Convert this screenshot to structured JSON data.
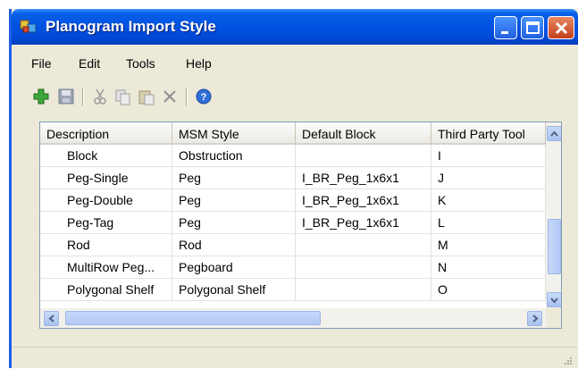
{
  "window": {
    "title": "Planogram Import Style"
  },
  "menu": [
    "File",
    "Edit",
    "Tools",
    "Help"
  ],
  "toolbar": {
    "icons": [
      "add-icon",
      "save-icon",
      "cut-icon",
      "copy-icon",
      "paste-icon",
      "delete-icon",
      "help-icon"
    ]
  },
  "grid": {
    "columns": [
      "Description",
      "MSM Style",
      "Default Block",
      "Third Party Tool"
    ],
    "rows": [
      [
        "Block",
        "Obstruction",
        "",
        "I"
      ],
      [
        "Peg-Single",
        "Peg",
        "I_BR_Peg_1x6x1",
        "J"
      ],
      [
        "Peg-Double",
        "Peg",
        "I_BR_Peg_1x6x1",
        "K"
      ],
      [
        "Peg-Tag",
        "Peg",
        "I_BR_Peg_1x6x1",
        "L"
      ],
      [
        "Rod",
        "Rod",
        "",
        "M"
      ],
      [
        "MultiRow Peg...",
        "Pegboard",
        "",
        "N"
      ],
      [
        "Polygonal Shelf",
        "Polygonal Shelf",
        "",
        "O"
      ]
    ]
  },
  "colors": {
    "titlebar": "#0054e3",
    "window_bg": "#ece9d8",
    "grid_border": "#7f9db9",
    "scrollbar_thumb": "#b2c9f5",
    "close_button": "#c4401c"
  }
}
